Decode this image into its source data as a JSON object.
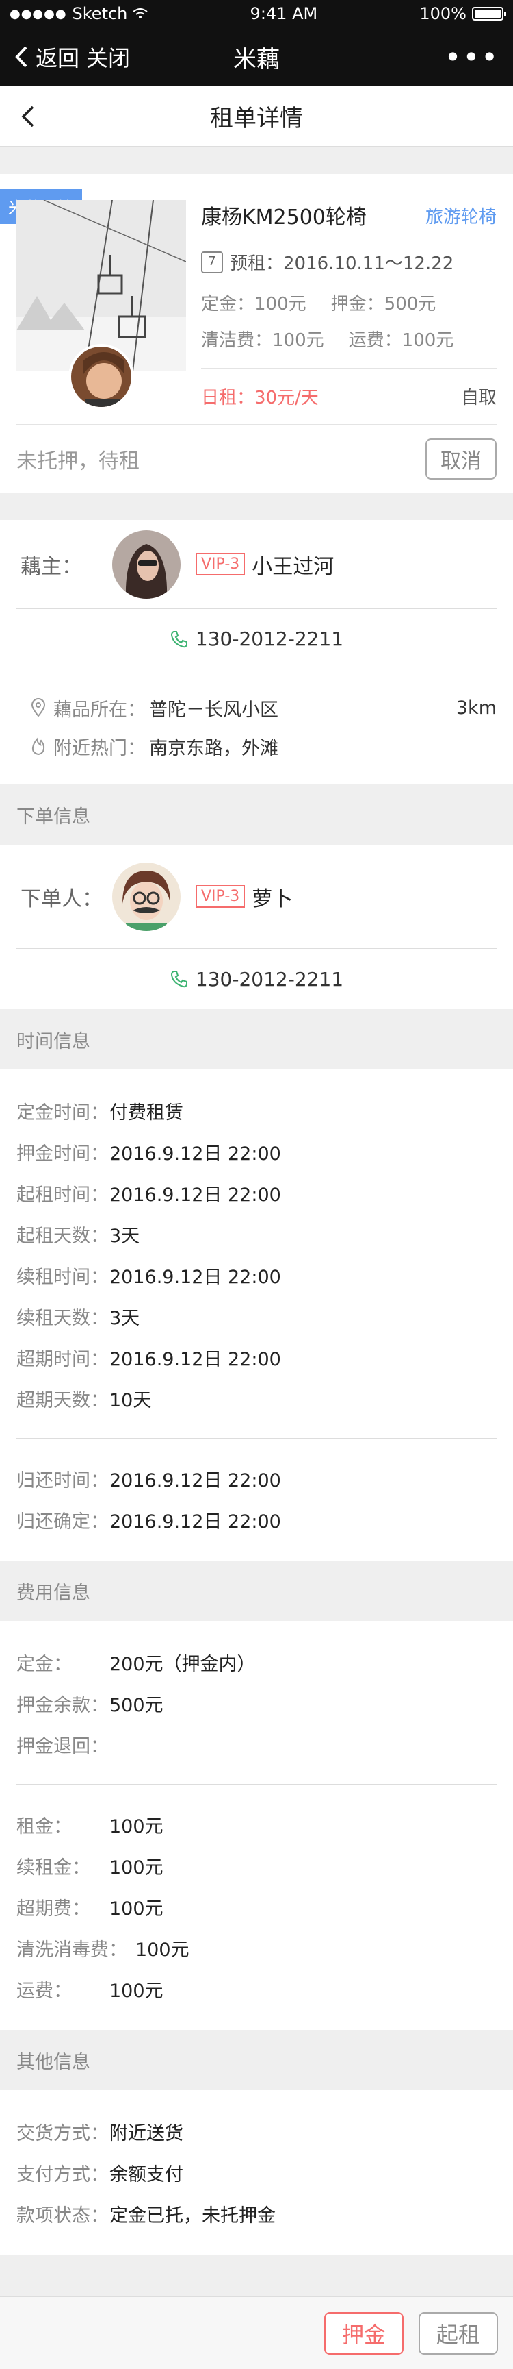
{
  "status_bar": {
    "carrier": "Sketch",
    "time": "9:41 AM",
    "battery": "100%"
  },
  "wechat_bar": {
    "back": "返回",
    "close": "关闭",
    "title": "米藕",
    "more": "•••"
  },
  "nav": {
    "title": "租单详情"
  },
  "product": {
    "badge": "米藕代管",
    "name": "康杨KM2500轮椅",
    "category": "旅游轮椅",
    "calendar_day": "7",
    "date_label": "预租：",
    "date_range": "2016.10.11～12.22",
    "deposit_label": "定金：",
    "deposit": "100元",
    "guarantee_label": "押金：",
    "guarantee": "500元",
    "clean_label": "清洁费：",
    "clean": "100元",
    "ship_label": "运费：",
    "ship": "100元",
    "daily_label": "日租：",
    "daily": "30元/天",
    "pickup": "自取"
  },
  "order_status": {
    "text": "未托押，待租",
    "cancel": "取消"
  },
  "owner": {
    "label": "藕主：",
    "vip": "VIP-3",
    "name": "小王过河",
    "phone": "130-2012-2211",
    "location_label": "藕品所在：",
    "location": "普陀－长风小区",
    "distance": "3km",
    "hot_label": "附近热门：",
    "hot": "南京东路，外滩"
  },
  "order_info": {
    "header": "下单信息",
    "label": "下单人：",
    "vip": "VIP-3",
    "name": "萝卜",
    "phone": "130-2012-2211"
  },
  "time_info": {
    "header": "时间信息",
    "rows": [
      {
        "label": "定金时间：",
        "value": "付费租赁"
      },
      {
        "label": "押金时间：",
        "value": "2016.9.12日 22:00"
      },
      {
        "label": "起租时间：",
        "value": "2016.9.12日 22:00"
      },
      {
        "label": "起租天数：",
        "value": "3天"
      },
      {
        "label": "续租时间：",
        "value": "2016.9.12日 22:00"
      },
      {
        "label": "续租天数：",
        "value": "3天"
      },
      {
        "label": "超期时间：",
        "value": "2016.9.12日 22:00"
      },
      {
        "label": "超期天数：",
        "value": "10天"
      }
    ],
    "return_rows": [
      {
        "label": "归还时间：",
        "value": "2016.9.12日 22:00"
      },
      {
        "label": "归还确定：",
        "value": "2016.9.12日 22:00"
      }
    ]
  },
  "fee_info": {
    "header": "费用信息",
    "rows": [
      {
        "label": "定金：",
        "value": "200元（押金内）"
      },
      {
        "label": "押金余款：",
        "value": "500元"
      },
      {
        "label": "押金退回：",
        "value": ""
      }
    ],
    "rows2": [
      {
        "label": "租金：",
        "value": "100元"
      },
      {
        "label": "续租金：",
        "value": "100元"
      },
      {
        "label": "超期费：",
        "value": "100元"
      },
      {
        "label": "清洗消毒费：",
        "value": "100元"
      },
      {
        "label": "运费：",
        "value": "100元"
      }
    ]
  },
  "other_info": {
    "header": "其他信息",
    "rows": [
      {
        "label": "交货方式：",
        "value": "附近送货"
      },
      {
        "label": "支付方式：",
        "value": "余额支付"
      },
      {
        "label": "款项状态：",
        "value": "定金已托，未托押金"
      }
    ]
  },
  "bottom": {
    "deposit_btn": "押金",
    "rent_btn": "起租"
  },
  "colors": {
    "accent_blue": "#5f9bf0",
    "accent_red": "#f56c6c",
    "phone_green": "#3cb371"
  }
}
